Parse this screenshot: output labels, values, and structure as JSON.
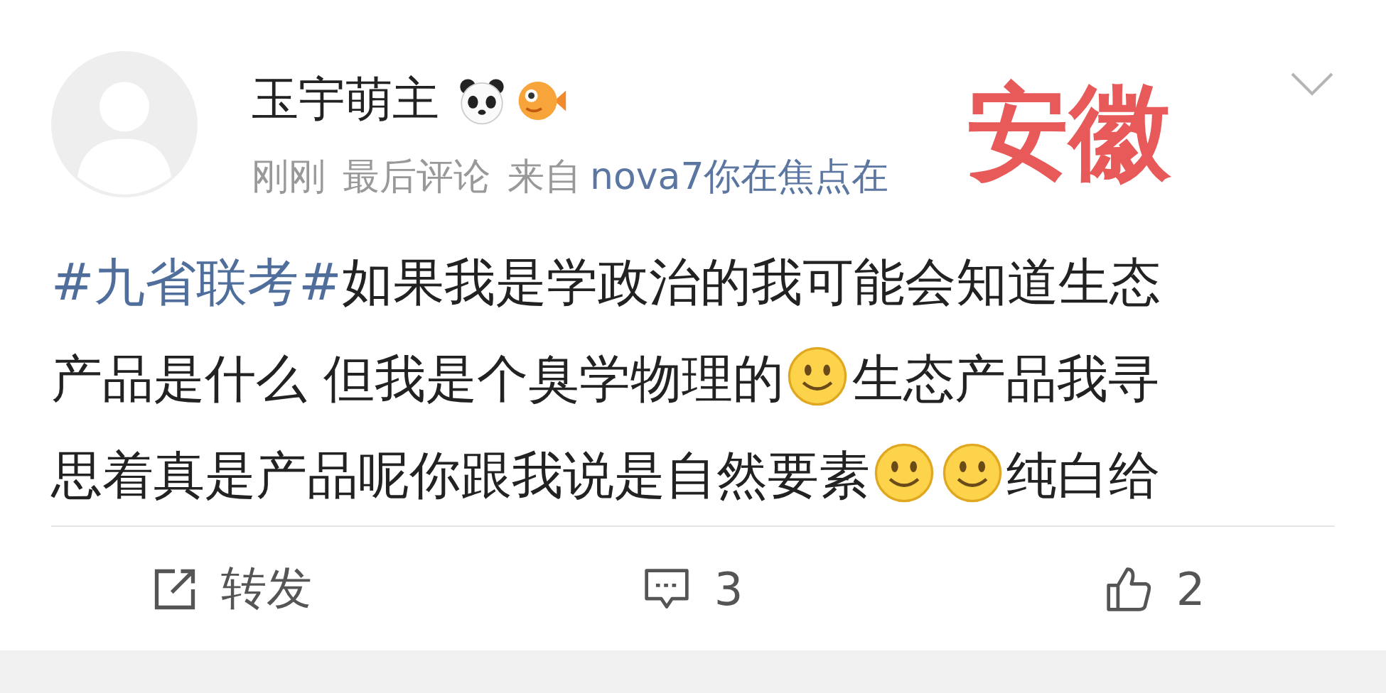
{
  "post": {
    "author": "玉宇萌主",
    "time": "刚刚",
    "status": "最后评论",
    "source_prefix": "来自",
    "source": "nova7你在焦点在",
    "annotation": "安徽",
    "body": [
      {
        "kind": "hashtag",
        "text": "#九省联考#"
      },
      {
        "kind": "text",
        "text": "如果我是学政治的我可能会知道生态产品是什么 但我是个臭学物理的"
      },
      {
        "kind": "emoji"
      },
      {
        "kind": "text",
        "text": "生态产品我寻思着真是产品呢你跟我说是自然要素"
      },
      {
        "kind": "emoji"
      },
      {
        "kind": "emoji"
      },
      {
        "kind": "text",
        "text": "纯白给"
      }
    ]
  },
  "actions": [
    {
      "kind": "repost",
      "label": "转发"
    },
    {
      "kind": "comment",
      "label": "3"
    },
    {
      "kind": "like",
      "label": "2"
    }
  ]
}
